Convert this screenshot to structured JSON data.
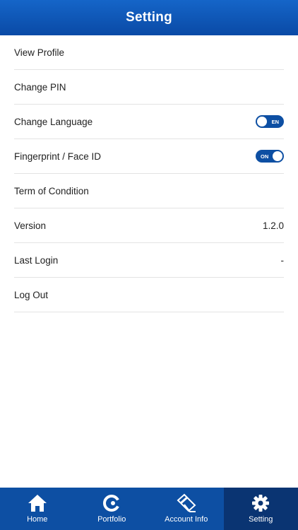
{
  "header": {
    "title": "Setting"
  },
  "settings": {
    "view_profile": "View Profile",
    "change_pin": "Change PIN",
    "change_language": "Change Language",
    "change_language_toggle": "EN",
    "fingerprint": "Fingerprint / Face ID",
    "fingerprint_toggle": "ON",
    "term": "Term of Condition",
    "version_label": "Version",
    "version_value": "1.2.0",
    "last_login_label": "Last Login",
    "last_login_value": "-",
    "logout": "Log Out"
  },
  "tabs": {
    "home": "Home",
    "portfolio": "Portfolio",
    "account_info": "Account Info",
    "setting": "Setting"
  },
  "colors": {
    "brand": "#0d4fa3",
    "active_tab": "#0a3472"
  }
}
